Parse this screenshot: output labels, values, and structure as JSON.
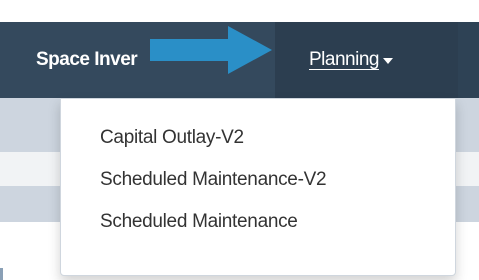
{
  "navbar": {
    "space_label": "Space Inver",
    "planning_label": "Planning",
    "planning_caret_icon": "caret-down-icon"
  },
  "annotation": {
    "arrow_icon": "right-arrow-icon",
    "arrow_color": "#2a8fc7"
  },
  "dropdown": {
    "items": [
      {
        "label": "Capital Outlay-V2"
      },
      {
        "label": "Scheduled Maintenance-V2"
      },
      {
        "label": "Scheduled Maintenance"
      }
    ]
  },
  "colors": {
    "navbar_bg": "#34495d",
    "navbar_active_bg": "#2c3e50",
    "subbar_bg": "#cdd5df",
    "menu_text": "#333333"
  }
}
